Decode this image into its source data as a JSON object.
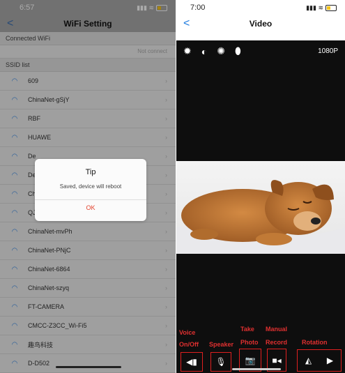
{
  "left": {
    "time": "6:57",
    "title": "WiFi Setting",
    "back_glyph": "<",
    "connected_header": "Connected WiFi",
    "connected_status": "Not connect",
    "ssid_header": "SSID list",
    "ssids": [
      "609",
      "ChinaNet-gSjY",
      "RBF",
      "HUAWE",
      "De",
      "De",
      "Ch",
      "QJKJ",
      "ChinaNet-mvPh",
      "ChinaNet-PNjC",
      "ChinaNet-6864",
      "ChinaNet-szyq",
      "FT-CAMERA",
      "CMCC-Z3CC_Wi-Fi5",
      "趣鸟科技",
      "D-D502"
    ],
    "dialog": {
      "title": "Tip",
      "message": "Saved, device will reboot",
      "ok": "OK"
    },
    "wifi_icon": "wifi-icon",
    "accent": "#3b8be6"
  },
  "right": {
    "time": "7:00",
    "title": "Video",
    "back_glyph": "<",
    "resolution": "1080P",
    "annotations": {
      "voice": "Voice",
      "onoff": "On/Off",
      "speaker": "Speaker",
      "take": "Take",
      "photo": "Photo",
      "manual": "Manual",
      "record": "Record",
      "rotation": "Rotation"
    },
    "annotation_color": "#e02020"
  }
}
